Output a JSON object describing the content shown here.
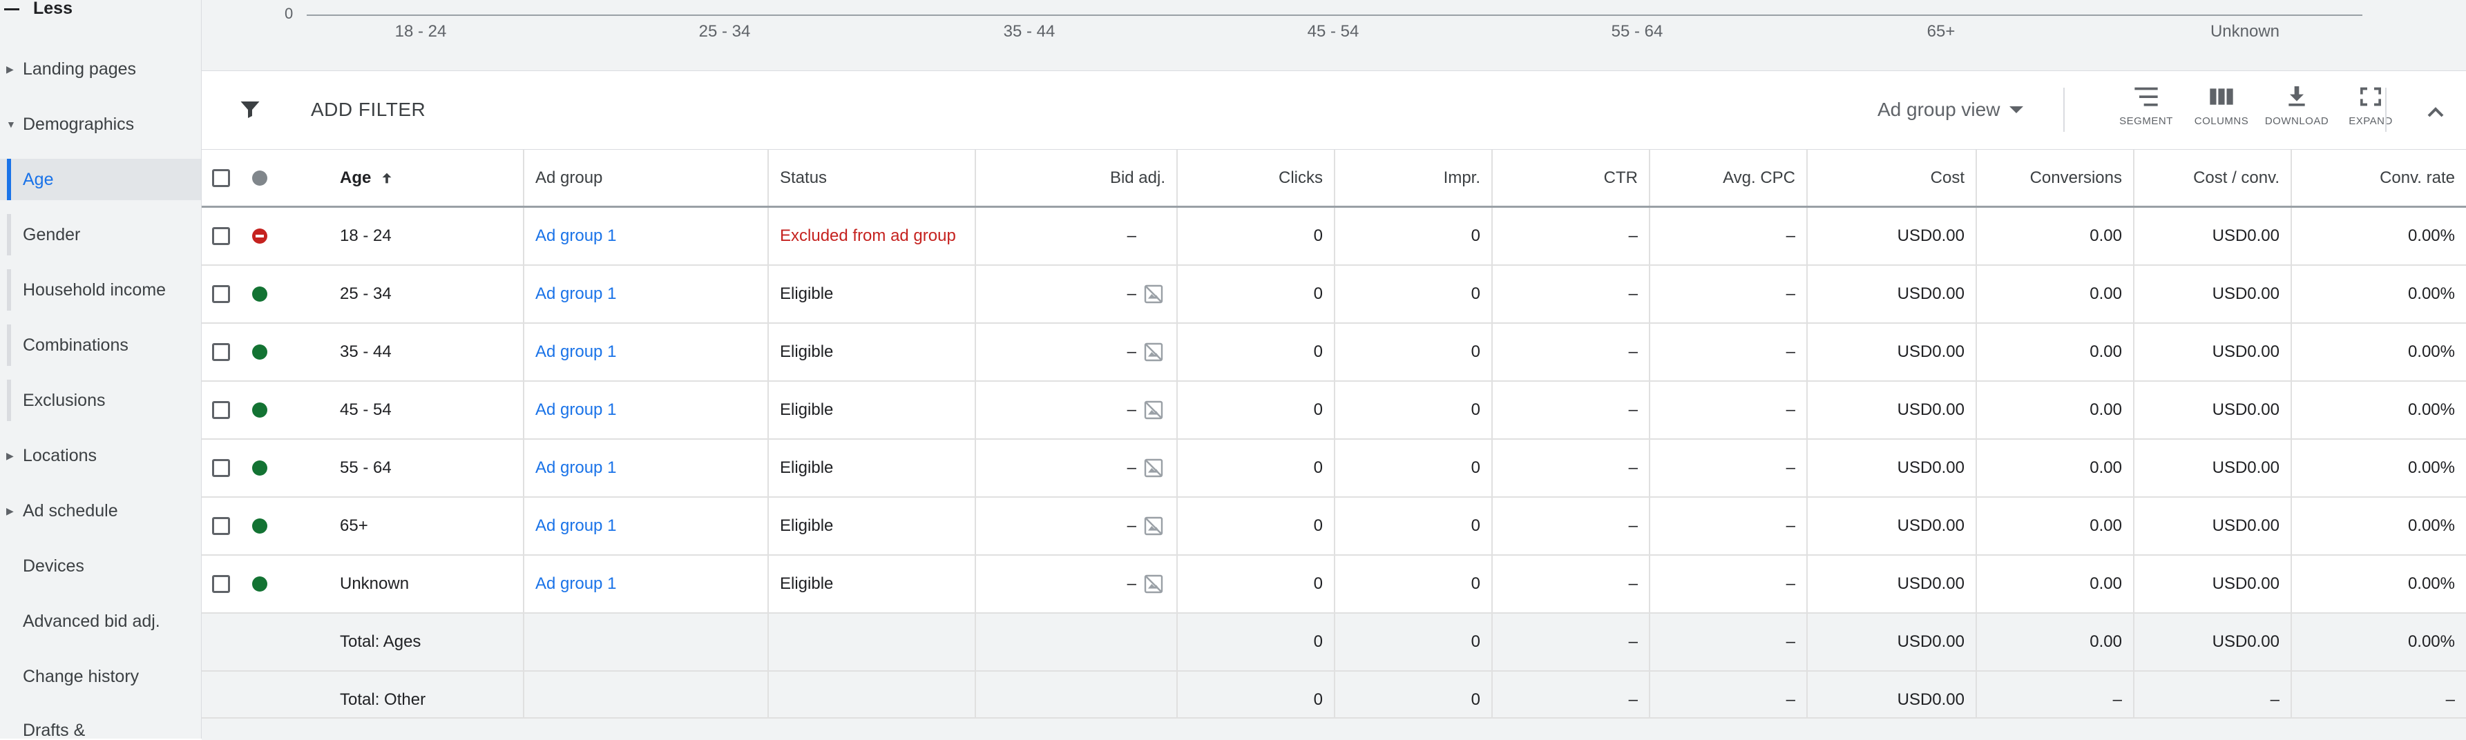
{
  "sidebar": {
    "less_label": "Less",
    "items": [
      {
        "label": "Landing pages",
        "expandable": true
      },
      {
        "label": "Demographics",
        "expanded": true
      },
      {
        "label": "Age",
        "active": true
      },
      {
        "label": "Gender"
      },
      {
        "label": "Household income"
      },
      {
        "label": "Combinations"
      },
      {
        "label": "Exclusions"
      },
      {
        "label": "Locations",
        "expandable": true
      },
      {
        "label": "Ad schedule",
        "expandable": true
      },
      {
        "label": "Devices"
      },
      {
        "label": "Advanced bid adj."
      },
      {
        "label": "Change history"
      },
      {
        "label": "Drafts &"
      }
    ]
  },
  "chart": {
    "zero_label": "0",
    "ticks": [
      "18 - 24",
      "25 - 34",
      "35 - 44",
      "45 - 54",
      "55 - 64",
      "65+",
      "Unknown"
    ]
  },
  "toolbar": {
    "add_filter": "ADD FILTER",
    "view_select": "Ad group view",
    "segment": "SEGMENT",
    "columns": "COLUMNS",
    "download": "DOWNLOAD",
    "expand": "EXPAND"
  },
  "table": {
    "headers": {
      "age": "Age",
      "ad_group": "Ad group",
      "status": "Status",
      "bid_adj": "Bid adj.",
      "clicks": "Clicks",
      "impr": "Impr.",
      "ctr": "CTR",
      "avg_cpc": "Avg. CPC",
      "cost": "Cost",
      "conversions": "Conversions",
      "cost_conv": "Cost / conv.",
      "conv_rate": "Conv. rate"
    },
    "rows": [
      {
        "age": "18 - 24",
        "ad_group": "Ad group 1",
        "status": "Excluded from ad group",
        "bid_adj": "–",
        "clicks": "0",
        "impr": "0",
        "ctr": "–",
        "avg_cpc": "–",
        "cost": "USD0.00",
        "conversions": "0.00",
        "cost_conv": "USD0.00",
        "conv_rate": "0.00%"
      },
      {
        "age": "25 - 34",
        "ad_group": "Ad group 1",
        "status": "Eligible",
        "bid_adj": "–",
        "clicks": "0",
        "impr": "0",
        "ctr": "–",
        "avg_cpc": "–",
        "cost": "USD0.00",
        "conversions": "0.00",
        "cost_conv": "USD0.00",
        "conv_rate": "0.00%"
      },
      {
        "age": "35 - 44",
        "ad_group": "Ad group 1",
        "status": "Eligible",
        "bid_adj": "–",
        "clicks": "0",
        "impr": "0",
        "ctr": "–",
        "avg_cpc": "–",
        "cost": "USD0.00",
        "conversions": "0.00",
        "cost_conv": "USD0.00",
        "conv_rate": "0.00%"
      },
      {
        "age": "45 - 54",
        "ad_group": "Ad group 1",
        "status": "Eligible",
        "bid_adj": "–",
        "clicks": "0",
        "impr": "0",
        "ctr": "–",
        "avg_cpc": "–",
        "cost": "USD0.00",
        "conversions": "0.00",
        "cost_conv": "USD0.00",
        "conv_rate": "0.00%"
      },
      {
        "age": "55 - 64",
        "ad_group": "Ad group 1",
        "status": "Eligible",
        "bid_adj": "–",
        "clicks": "0",
        "impr": "0",
        "ctr": "–",
        "avg_cpc": "–",
        "cost": "USD0.00",
        "conversions": "0.00",
        "cost_conv": "USD0.00",
        "conv_rate": "0.00%"
      },
      {
        "age": "65+",
        "ad_group": "Ad group 1",
        "status": "Eligible",
        "bid_adj": "–",
        "clicks": "0",
        "impr": "0",
        "ctr": "–",
        "avg_cpc": "–",
        "cost": "USD0.00",
        "conversions": "0.00",
        "cost_conv": "USD0.00",
        "conv_rate": "0.00%"
      },
      {
        "age": "Unknown",
        "ad_group": "Ad group 1",
        "status": "Eligible",
        "bid_adj": "–",
        "clicks": "0",
        "impr": "0",
        "ctr": "–",
        "avg_cpc": "–",
        "cost": "USD0.00",
        "conversions": "0.00",
        "cost_conv": "USD0.00",
        "conv_rate": "0.00%"
      }
    ],
    "totals": [
      {
        "label": "Total: Ages",
        "clicks": "0",
        "impr": "0",
        "ctr": "–",
        "avg_cpc": "–",
        "cost": "USD0.00",
        "conversions": "0.00",
        "cost_conv": "USD0.00",
        "conv_rate": "0.00%"
      },
      {
        "label": "Total: Other",
        "clicks": "0",
        "impr": "0",
        "ctr": "–",
        "avg_cpc": "–",
        "cost": "USD0.00",
        "conversions": "–",
        "cost_conv": "–",
        "conv_rate": "–"
      }
    ]
  },
  "colors": {
    "accent": "#1a73e8",
    "eligible": "#137333",
    "excluded": "#c5221f"
  }
}
